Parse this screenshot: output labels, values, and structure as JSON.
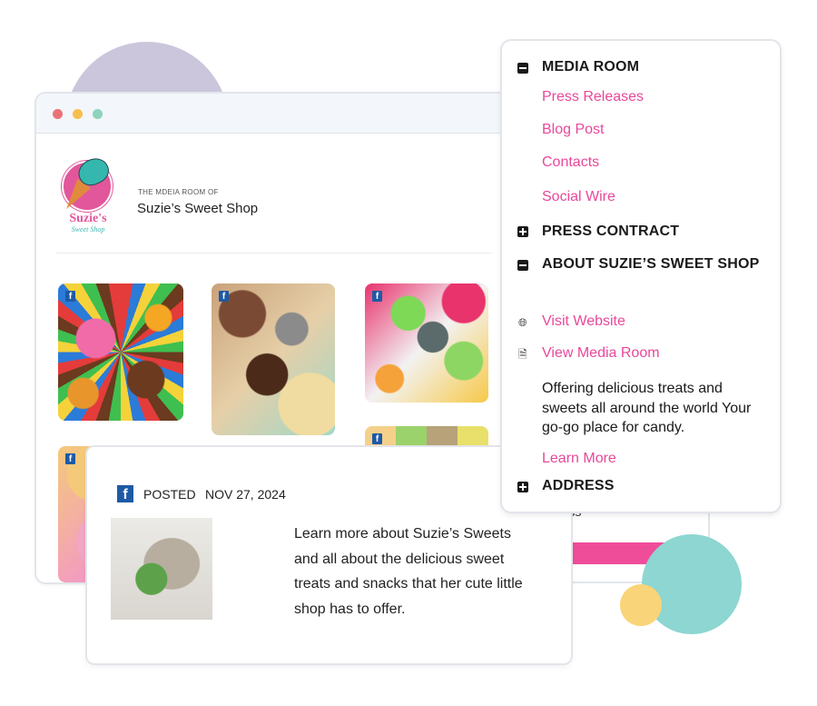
{
  "browser": {
    "header": {
      "eyebrow": "THE MDEIA ROOM OF",
      "shop_name": "Suzie’s Sweet Shop",
      "logo_line1": "Suzie's",
      "logo_line2": "Sweet Shop"
    },
    "tiles": [
      {
        "label": "candy-mix-image",
        "badge": "f"
      },
      {
        "label": "cookies-image",
        "badge": "f"
      },
      {
        "label": "gummies-image",
        "badge": "f"
      },
      {
        "label": "macarons-image",
        "badge": "f"
      },
      {
        "label": "cupcakes-image",
        "badge": "f"
      }
    ],
    "address_label": "Address"
  },
  "post": {
    "badge": "f",
    "posted_label": "POSTED",
    "date": "NOV 27, 2024",
    "text": "Learn more about Suzie’s Sweets and all about the delicious sweet treats and snacks that her cute little shop has to offer."
  },
  "menu": {
    "media_room": {
      "title": "MEDIA ROOM",
      "state": "expanded",
      "items": [
        "Press Releases",
        "Blog Post",
        "Contacts",
        "Social Wire"
      ]
    },
    "press_contract": {
      "title": "PRESS CONTRACT",
      "state": "collapsed"
    },
    "about": {
      "title": "ABOUT SUZIE’S SWEET SHOP",
      "state": "expanded",
      "visit_website": "Visit Website",
      "view_media_room": "View Media Room",
      "description": "Offering delicious treats and sweets all around the world Your go-go place for candy.",
      "learn_more": "Learn More"
    },
    "address": {
      "title": "ADDRESS",
      "state": "collapsed"
    }
  },
  "colors": {
    "accent_pink": "#e8489a",
    "facebook_blue": "#1e5aa5",
    "deco_purple": "#cbc6dc",
    "deco_teal": "#8dd6d2",
    "deco_yellow": "#f9d478"
  }
}
